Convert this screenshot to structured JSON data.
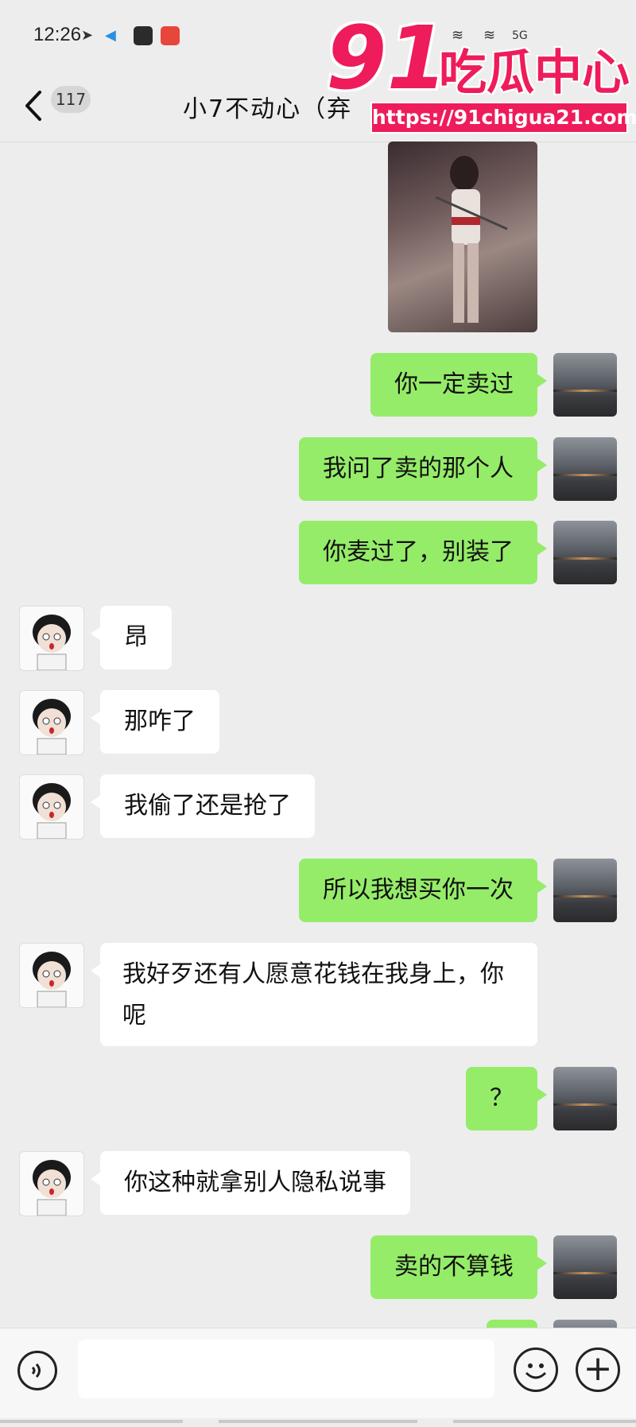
{
  "status_bar": {
    "time": "12:26",
    "signal": "5G"
  },
  "header": {
    "unread_count": "117",
    "title": "小7不动心（弃"
  },
  "watermark": {
    "number": "91",
    "name": "吃瓜中心",
    "url": "https://91chigua21.com"
  },
  "messages": [
    {
      "side": "right",
      "text": "你一定卖过"
    },
    {
      "side": "right",
      "text": "我问了卖的那个人"
    },
    {
      "side": "right",
      "text": "你麦过了，别装了"
    },
    {
      "side": "left",
      "text": "昂"
    },
    {
      "side": "left",
      "text": "那咋了"
    },
    {
      "side": "left",
      "text": "我偷了还是抢了"
    },
    {
      "side": "right",
      "text": "所以我想买你一次"
    },
    {
      "side": "left",
      "text": "我好歹还有人愿意花钱在我身上，你呢"
    },
    {
      "side": "right",
      "text": "？"
    },
    {
      "side": "left",
      "text": "你这种就拿别人隐私说事"
    },
    {
      "side": "right",
      "text": "卖的不算钱"
    }
  ],
  "input": {
    "placeholder": ""
  },
  "colors": {
    "self_bubble": "#95ec69",
    "other_bubble": "#ffffff",
    "background": "#ededed",
    "watermark": "#ee1c5a"
  }
}
